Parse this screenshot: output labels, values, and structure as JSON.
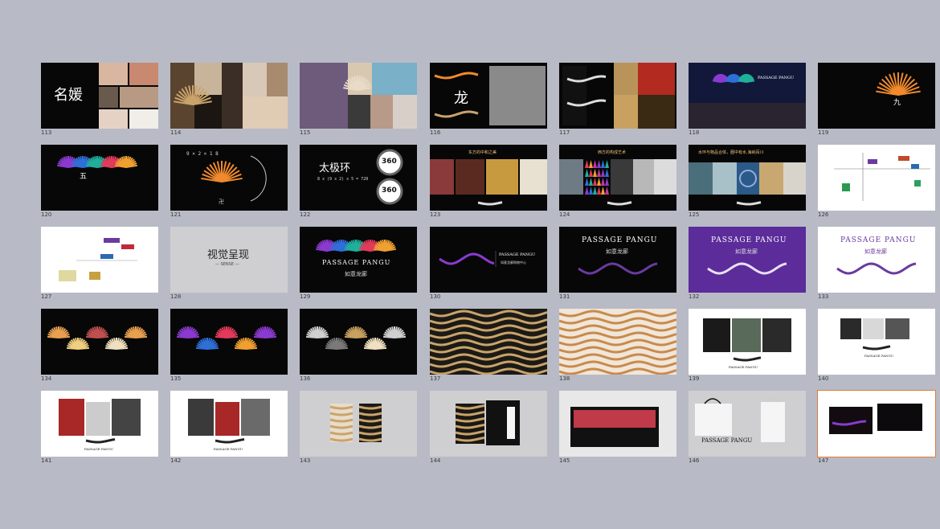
{
  "colors": {
    "background": "#b8bbc6",
    "selection": "#e07b3a",
    "fan_orange": "#f08a2c",
    "purple": "#5b2c9a",
    "gold": "#c9a46a"
  },
  "slides": [
    {
      "number": "113",
      "theme": "dark",
      "caption": "名媛"
    },
    {
      "number": "114",
      "theme": "photo"
    },
    {
      "number": "115",
      "theme": "photo"
    },
    {
      "number": "116",
      "theme": "dark",
      "caption": "龙"
    },
    {
      "number": "117",
      "theme": "dark"
    },
    {
      "number": "118",
      "theme": "dark",
      "logo": "PASSAGE PANGU"
    },
    {
      "number": "119",
      "theme": "dark",
      "caption": "九"
    },
    {
      "number": "120",
      "theme": "dark",
      "caption": "五"
    },
    {
      "number": "121",
      "theme": "dark",
      "formula": "9 × 2 × 1 8",
      "caption": "卍"
    },
    {
      "number": "122",
      "theme": "dark",
      "caption": "太极环",
      "formula": "8 x (9 x 2) x 5 = 720",
      "badge_top": "360",
      "badge_bottom": "360"
    },
    {
      "number": "123",
      "theme": "dark",
      "caption": "东方的中和之美"
    },
    {
      "number": "124",
      "theme": "dark",
      "caption": "西方的构成艺术"
    },
    {
      "number": "125",
      "theme": "dark",
      "caption": "水环与物品合体，圈中有水,海纳百川"
    },
    {
      "number": "126",
      "theme": "light"
    },
    {
      "number": "127",
      "theme": "light"
    },
    {
      "number": "128",
      "theme": "gray",
      "caption": "视觉呈现",
      "subcaption": "— SENSE —"
    },
    {
      "number": "129",
      "theme": "dark",
      "logo": "PASSAGE PANGU",
      "subtitle": "如意龙廊"
    },
    {
      "number": "130",
      "theme": "dark",
      "logo": "PASSAGE PANGU",
      "subtitle": "如意龙廊购物中心"
    },
    {
      "number": "131",
      "theme": "dark",
      "logo": "PASSAGE PANGU",
      "subtitle": "如意龙廊"
    },
    {
      "number": "132",
      "theme": "purple",
      "logo": "PASSAGE PANGU",
      "subtitle": "如意龙廊"
    },
    {
      "number": "133",
      "theme": "light",
      "logo": "PASSAGE PANGU",
      "subtitle": "如意龙廊"
    },
    {
      "number": "134",
      "theme": "dark"
    },
    {
      "number": "135",
      "theme": "dark"
    },
    {
      "number": "136",
      "theme": "dark"
    },
    {
      "number": "137",
      "theme": "pattern-dark"
    },
    {
      "number": "138",
      "theme": "pattern-light"
    },
    {
      "number": "139",
      "theme": "light",
      "logo": "PASSAGE PANGU"
    },
    {
      "number": "140",
      "theme": "light",
      "logo": "PASSAGE PANGU"
    },
    {
      "number": "141",
      "theme": "light",
      "logo": "PASSAGE PANGU"
    },
    {
      "number": "142",
      "theme": "light",
      "logo": "PASSAGE PANGU"
    },
    {
      "number": "143",
      "theme": "gray"
    },
    {
      "number": "144",
      "theme": "gray"
    },
    {
      "number": "145",
      "theme": "light"
    },
    {
      "number": "146",
      "theme": "gray",
      "logo": "PASSAGE PANGU"
    },
    {
      "number": "147",
      "theme": "light",
      "selected": true
    }
  ]
}
